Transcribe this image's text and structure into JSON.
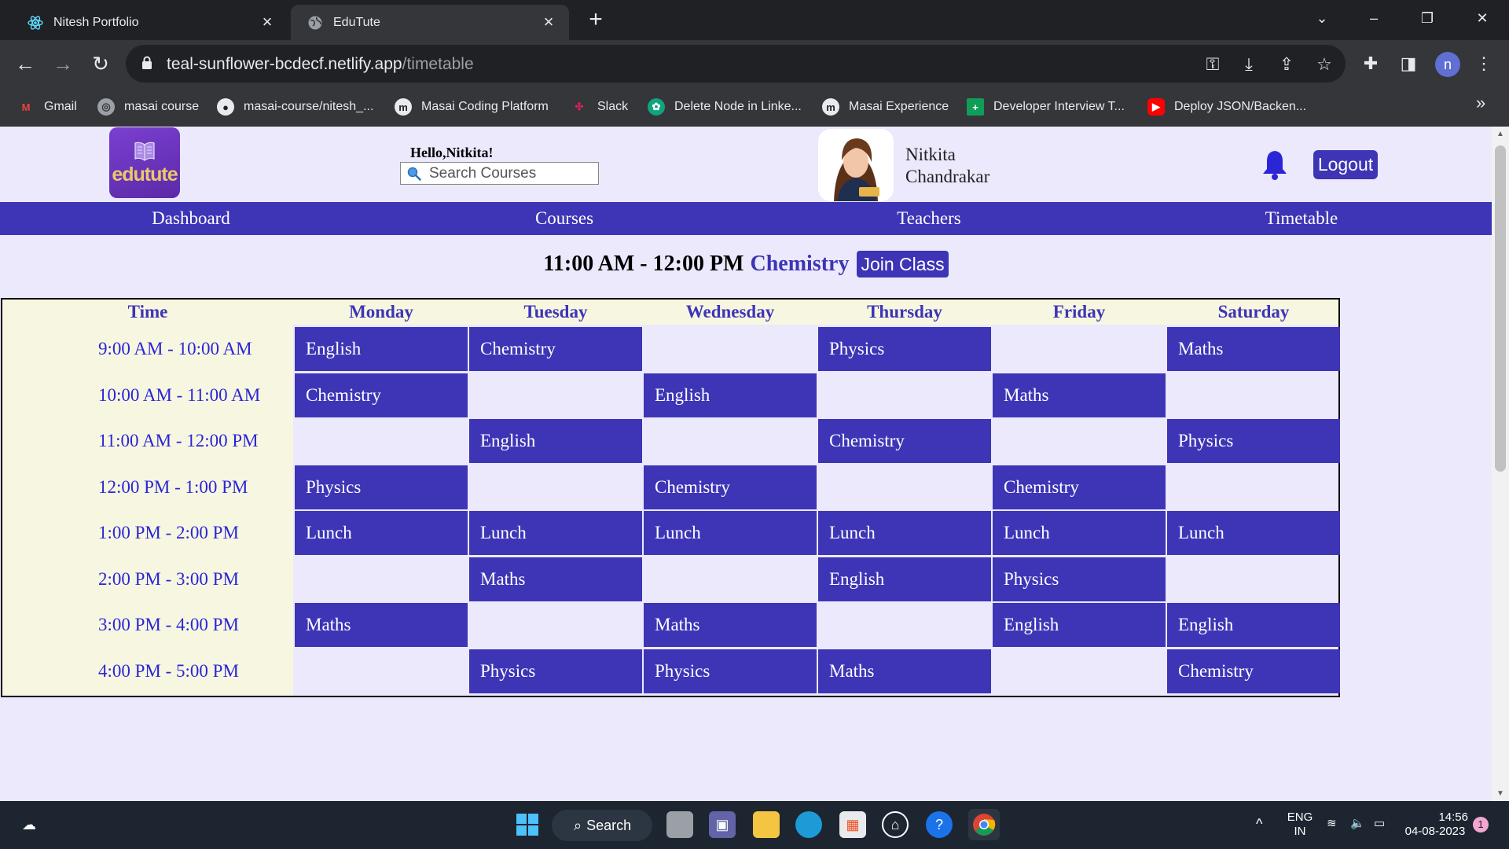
{
  "browser": {
    "tabs": [
      {
        "title": "Nitesh Portfolio",
        "active": false
      },
      {
        "title": "EduTute",
        "active": true
      }
    ],
    "url_host": "teal-sunflower-bcdecf.netlify.app",
    "url_path": "/timetable",
    "profile_initial": "n",
    "bookmarks": [
      "Gmail",
      "masai course",
      "masai-course/nitesh_...",
      "Masai Coding Platform",
      "Slack",
      "Delete Node in Linke...",
      "Masai Experience",
      "Developer Interview T...",
      "Deploy JSON/Backen..."
    ]
  },
  "header": {
    "logo_text": "edutute",
    "greeting": "Hello,Nitkita!",
    "search_placeholder": "Search Courses",
    "user_first": "Nitkita",
    "user_last": "Chandrakar",
    "logout_label": "Logout"
  },
  "nav": [
    "Dashboard",
    "Courses",
    "Teachers",
    "Timetable"
  ],
  "current_class": {
    "time": "11:00 AM - 12:00 PM",
    "subject": "Chemistry",
    "join_label": "Join Class"
  },
  "timetable": {
    "time_header": "Time",
    "days": [
      "Monday",
      "Tuesday",
      "Wednesday",
      "Thursday",
      "Friday",
      "Saturday"
    ],
    "rows": [
      {
        "time": "9:00 AM - 10:00 AM",
        "cells": [
          "English",
          "Chemistry",
          "",
          "Physics",
          "",
          "Maths"
        ]
      },
      {
        "time": "10:00 AM - 11:00 AM",
        "cells": [
          "Chemistry",
          "",
          "English",
          "",
          "Maths",
          ""
        ]
      },
      {
        "time": "11:00 AM - 12:00 PM",
        "cells": [
          "",
          "English",
          "",
          "Chemistry",
          "",
          "Physics"
        ]
      },
      {
        "time": "12:00 PM - 1:00 PM",
        "cells": [
          "Physics",
          "",
          "Chemistry",
          "",
          "Chemistry",
          ""
        ]
      },
      {
        "time": "1:00 PM - 2:00 PM",
        "cells": [
          "Lunch",
          "Lunch",
          "Lunch",
          "Lunch",
          "Lunch",
          "Lunch"
        ]
      },
      {
        "time": "2:00 PM - 3:00 PM",
        "cells": [
          "",
          "Maths",
          "",
          "English",
          "Physics",
          ""
        ]
      },
      {
        "time": "3:00 PM - 4:00 PM",
        "cells": [
          "Maths",
          "",
          "Maths",
          "",
          "English",
          "English"
        ]
      },
      {
        "time": "4:00 PM - 5:00 PM",
        "cells": [
          "",
          "Physics",
          "Physics",
          "Maths",
          "",
          "Chemistry"
        ]
      }
    ]
  },
  "taskbar": {
    "search_label": "Search",
    "lang": "ENG",
    "region": "IN",
    "time": "14:56",
    "date": "04-08-2023",
    "notification_count": "1"
  },
  "colors": {
    "primary": "#3d35b6",
    "page_bg": "#ebe9fb",
    "time_col_bg": "#f7f6e1"
  }
}
